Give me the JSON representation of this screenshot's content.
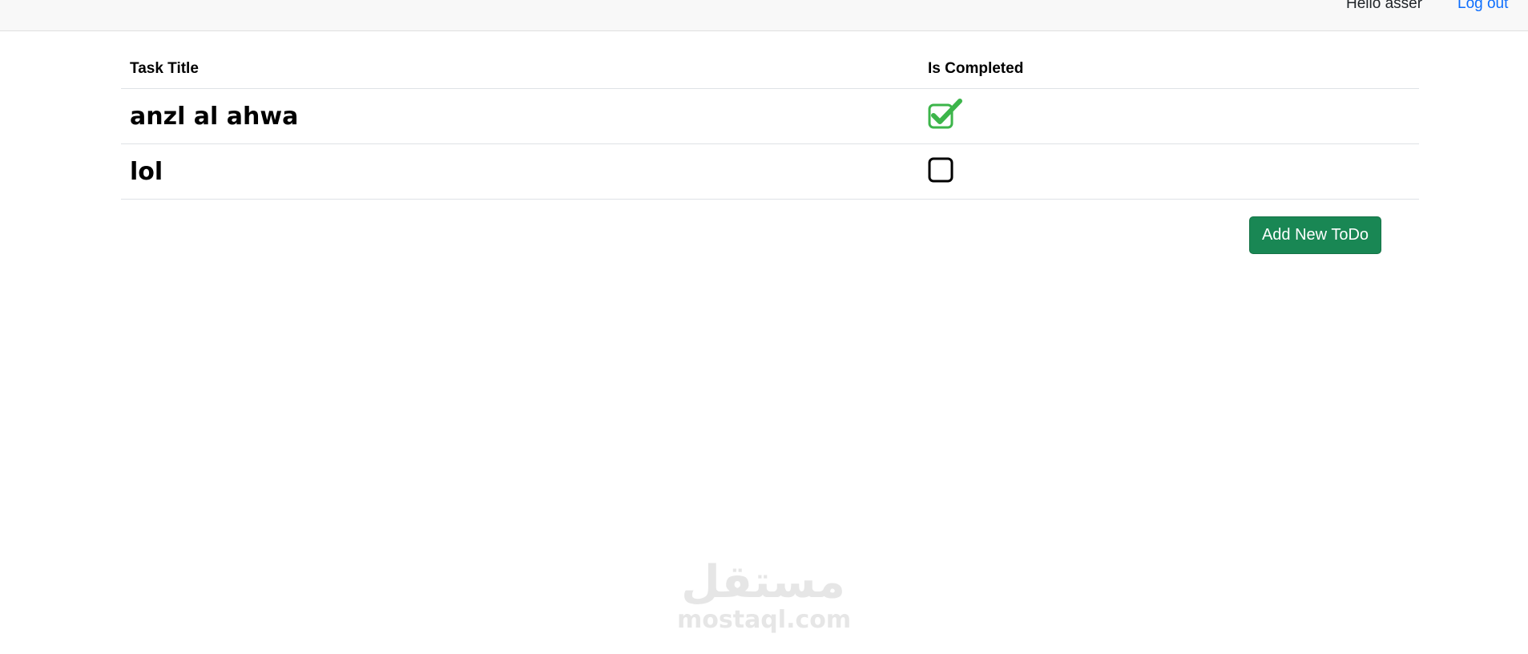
{
  "header": {
    "greeting": "Hello asser",
    "logout_label": "Log out"
  },
  "table": {
    "columns": [
      "Task Title",
      "Is Completed"
    ],
    "rows": [
      {
        "title": "anzl al ahwa",
        "completed": true
      },
      {
        "title": "lol",
        "completed": false
      }
    ]
  },
  "actions": {
    "add_label": "Add New ToDo"
  },
  "watermark": {
    "arabic": "مستقل",
    "latin": "mostaql.com"
  },
  "colors": {
    "accent_green": "#198754",
    "check_green": "#3cb54a",
    "link_blue": "#0d6efd",
    "topbar_bg": "#f8f8f8"
  },
  "icons": {
    "checked": "checkbox-checked-icon",
    "unchecked": "checkbox-empty-icon"
  }
}
